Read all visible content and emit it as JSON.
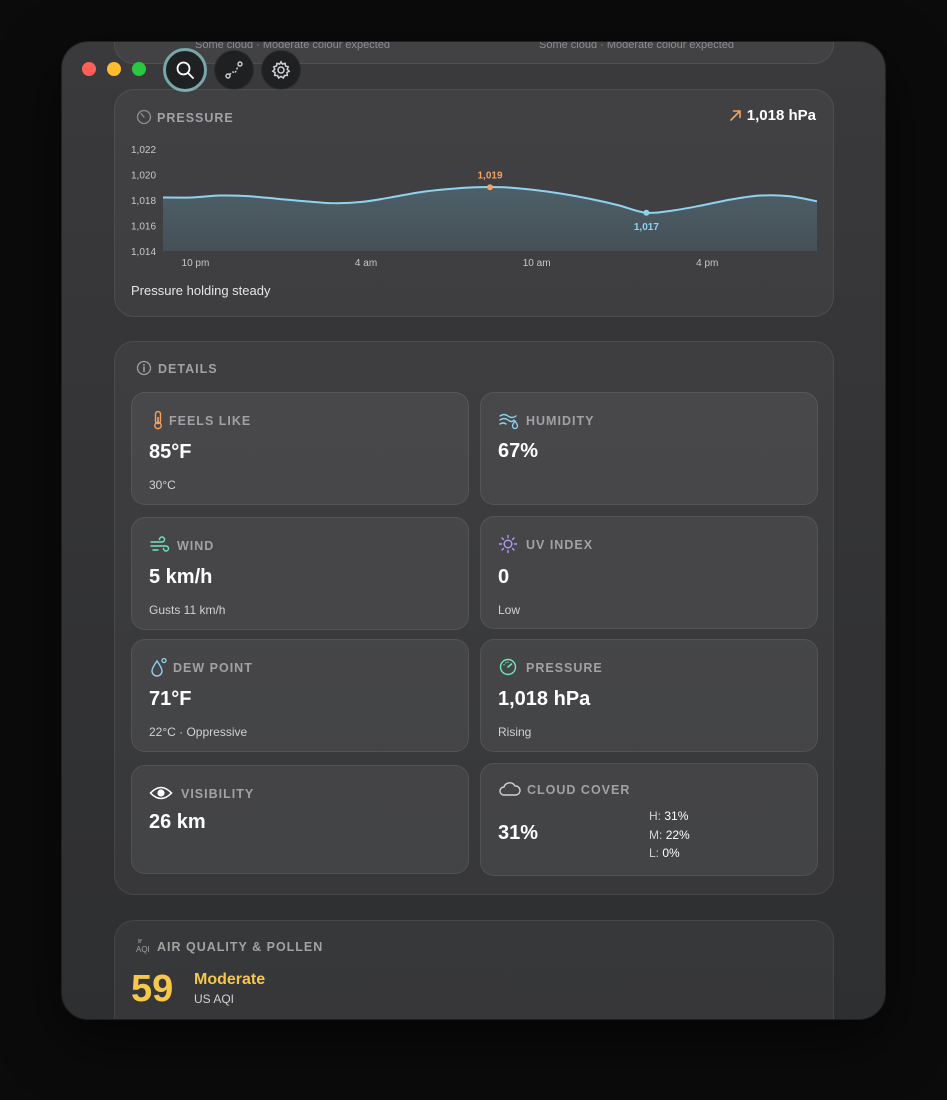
{
  "top_stub": {
    "left_text": "Some cloud · Moderate colour expected",
    "right_text": "Some cloud · Moderate colour expected"
  },
  "toolbar": {
    "search_icon": "magnifier-icon",
    "route_icon": "route-icon",
    "settings_icon": "gear-icon"
  },
  "pressure_chart": {
    "title": "PRESSURE",
    "current": "1,018 hPa",
    "trend_icon": "arrow-up-right-icon",
    "status": "Pressure holding steady",
    "colors": {
      "line": "#8fd3ef",
      "high": "#f4a261",
      "low": "#8fd3ef",
      "trend": "#f4a261"
    }
  },
  "chart_data": {
    "type": "area",
    "title": "PRESSURE",
    "xlabel": "",
    "ylabel": "",
    "x_tick_labels": [
      "10 pm",
      "4 am",
      "10 am",
      "4 pm"
    ],
    "y_tick_labels": [
      "1,022",
      "1,020",
      "1,018",
      "1,016",
      "1,014"
    ],
    "ylim": [
      1014,
      1022
    ],
    "hours": [
      21,
      22,
      23,
      24,
      25,
      26,
      27,
      28,
      29,
      30,
      31,
      32,
      33,
      34,
      35,
      36,
      37,
      38,
      39,
      40,
      41,
      42,
      43,
      44
    ],
    "values": [
      1018.2,
      1018.2,
      1018.35,
      1018.3,
      1018.1,
      1017.9,
      1017.75,
      1017.85,
      1018.2,
      1018.6,
      1018.85,
      1019.0,
      1019.0,
      1018.8,
      1018.5,
      1018.1,
      1017.6,
      1017.0,
      1017.2,
      1017.6,
      1018.05,
      1018.35,
      1018.3,
      1017.9
    ],
    "annotations": [
      {
        "label": "1,019",
        "hour": 32.5,
        "value": 1019.0,
        "kind": "high"
      },
      {
        "label": "1,017",
        "hour": 38.0,
        "value": 1017.0,
        "kind": "low"
      }
    ],
    "grid": false,
    "legend": "none"
  },
  "details": {
    "title": "DETAILS",
    "tiles": [
      {
        "title": "FEELS LIKE",
        "value": "85°F",
        "sub": "30°C",
        "icon": "thermometer-icon",
        "color": "#f4a261"
      },
      {
        "title": "HUMIDITY",
        "value": "67%",
        "sub": "",
        "icon": "humidity-icon",
        "color": "#8fd3ef"
      },
      {
        "title": "WIND",
        "value": "5 km/h",
        "sub": "Gusts 11 km/h",
        "icon": "wind-icon",
        "color": "#6ee7b7"
      },
      {
        "title": "UV INDEX",
        "value": "0",
        "sub": "Low",
        "icon": "sun-icon",
        "color": "#b49cf5"
      },
      {
        "title": "DEW POINT",
        "value": "71°F",
        "sub": "22°C · Oppressive",
        "icon": "drop-icon",
        "color": "#8fd3ef"
      },
      {
        "title": "PRESSURE",
        "value": "1,018 hPa",
        "sub": "Rising",
        "icon": "gauge-icon",
        "color": "#6ee7b7"
      },
      {
        "title": "VISIBILITY",
        "value": "26 km",
        "sub": "",
        "icon": "eye-icon",
        "color": "#ffffff"
      },
      {
        "title": "CLOUD COVER",
        "value": "31%",
        "sub": "",
        "icon": "cloud-icon",
        "color": "#d1d1d6"
      }
    ],
    "cloud_layers": [
      {
        "label": "H:",
        "value": "31%"
      },
      {
        "label": "M:",
        "value": "22%"
      },
      {
        "label": "L:",
        "value": "0%"
      }
    ]
  },
  "air_quality": {
    "title": "AIR QUALITY & POLLEN",
    "aqi_value": "59",
    "category": "Moderate",
    "scale": "US AQI",
    "color": "#f5c84c"
  }
}
